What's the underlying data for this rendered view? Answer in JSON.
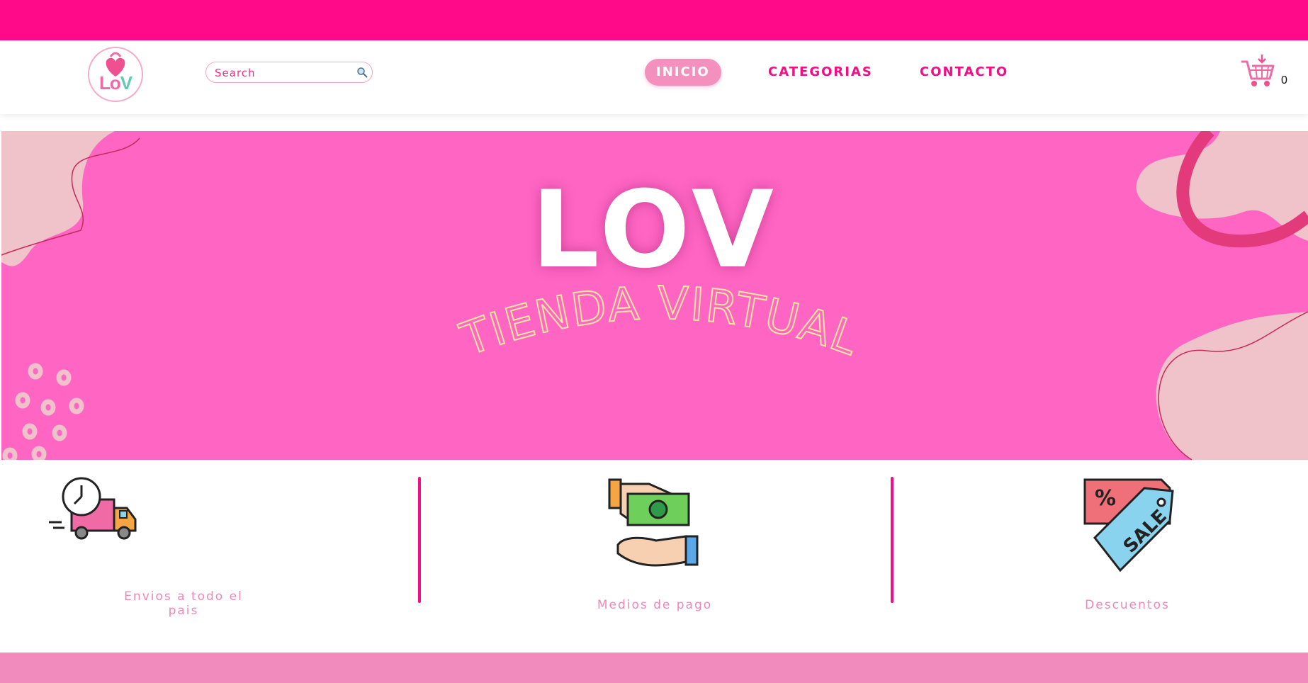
{
  "header": {
    "logo_text_part1": "Lo",
    "logo_text_part2": "V",
    "search": {
      "placeholder": "Search"
    },
    "nav": [
      {
        "label": "INICIO",
        "active": true
      },
      {
        "label": "CATEGORIAS",
        "active": false
      },
      {
        "label": "CONTACTO",
        "active": false
      }
    ],
    "cart_count": "0"
  },
  "banner": {
    "title": "LOV",
    "tagline": "TIENDA VIRTUAL"
  },
  "features": [
    {
      "label": "Envios a todo el pais",
      "icon": "delivery-truck-icon"
    },
    {
      "label": "Medios de pago",
      "icon": "payment-hands-icon"
    },
    {
      "label": "Descuentos",
      "icon": "sale-tag-icon"
    }
  ],
  "colors": {
    "topbar": "#ff0a88",
    "banner": "#ff66c4",
    "nav_text": "#f20f85",
    "nav_active_bg": "#f490bd",
    "feature_text": "#f087b9",
    "bottombar": "#f28bbd"
  }
}
